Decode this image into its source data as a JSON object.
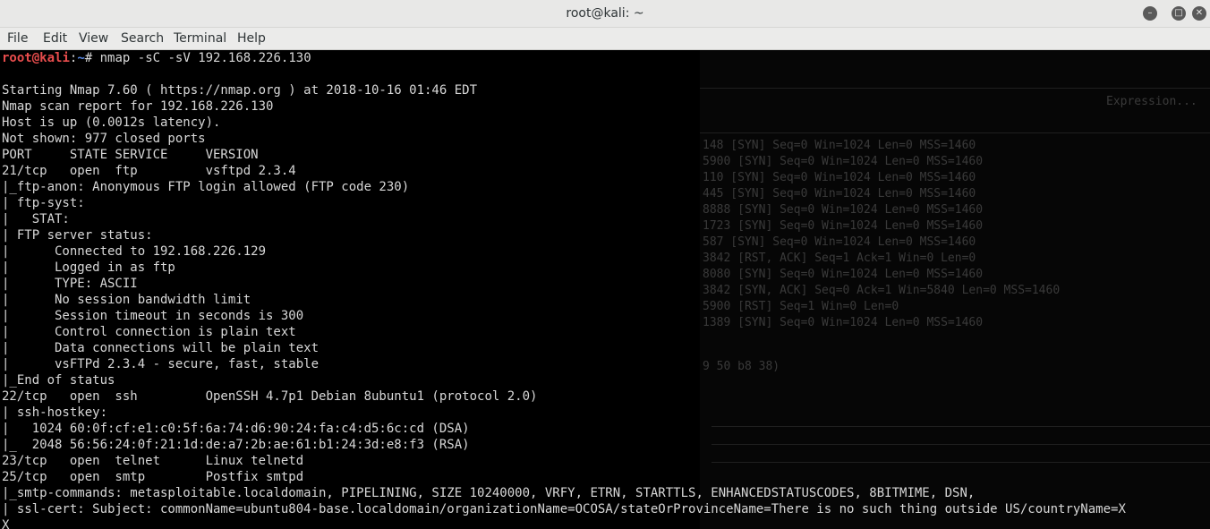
{
  "window": {
    "title": "root@kali: ~"
  },
  "menu": [
    "File",
    "Edit",
    "View",
    "Search",
    "Terminal",
    "Help"
  ],
  "prompt": {
    "user": "root",
    "at": "@",
    "host": "kali",
    "sep": ":",
    "path": "~",
    "symbol": "#",
    "command": " nmap -sC -sV 192.168.226.130"
  },
  "output": [
    "",
    "Starting Nmap 7.60 ( https://nmap.org ) at 2018-10-16 01:46 EDT",
    "Nmap scan report for 192.168.226.130",
    "Host is up (0.0012s latency).",
    "Not shown: 977 closed ports",
    "PORT     STATE SERVICE     VERSION",
    "21/tcp   open  ftp         vsftpd 2.3.4",
    "|_ftp-anon: Anonymous FTP login allowed (FTP code 230)",
    "| ftp-syst: ",
    "|   STAT: ",
    "| FTP server status:",
    "|      Connected to 192.168.226.129",
    "|      Logged in as ftp",
    "|      TYPE: ASCII",
    "|      No session bandwidth limit",
    "|      Session timeout in seconds is 300",
    "|      Control connection is plain text",
    "|      Data connections will be plain text",
    "|      vsFTPd 2.3.4 - secure, fast, stable",
    "|_End of status",
    "22/tcp   open  ssh         OpenSSH 4.7p1 Debian 8ubuntu1 (protocol 2.0)",
    "| ssh-hostkey: ",
    "|   1024 60:0f:cf:e1:c0:5f:6a:74:d6:90:24:fa:c4:d5:6c:cd (DSA)",
    "|_  2048 56:56:24:0f:21:1d:de:a7:2b:ae:61:b1:24:3d:e8:f3 (RSA)",
    "23/tcp   open  telnet      Linux telnetd",
    "25/tcp   open  smtp        Postfix smtpd",
    "|_smtp-commands: metasploitable.localdomain, PIPELINING, SIZE 10240000, VRFY, ETRN, STARTTLS, ENHANCEDSTATUSCODES, 8BITMIME, DSN,",
    "| ssl-cert: Subject: commonName=ubuntu804-base.localdomain/organizationName=OCOSA/stateOrProvinceName=There is no such thing outside US/countryName=X",
    "X"
  ],
  "background_ghost": [
    "148 [SYN] Seq=0 Win=1024 Len=0 MSS=1460",
    "5900 [SYN] Seq=0 Win=1024 Len=0 MSS=1460",
    "110 [SYN] Seq=0 Win=1024 Len=0 MSS=1460",
    "445 [SYN] Seq=0 Win=1024 Len=0 MSS=1460",
    "8888 [SYN] Seq=0 Win=1024 Len=0 MSS=1460",
    "1723 [SYN] Seq=0 Win=1024 Len=0 MSS=1460",
    "587 [SYN] Seq=0 Win=1024 Len=0 MSS=1460",
    "3842 [RST, ACK] Seq=1 Ack=1 Win=0 Len=0",
    "8080 [SYN] Seq=0 Win=1024 Len=0 MSS=1460",
    "3842 [SYN, ACK] Seq=0 Ack=1 Win=5840 Len=0 MSS=1460",
    "5900 [RST] Seq=1 Win=0 Len=0",
    "1389 [SYN] Seq=0 Win=1024 Len=0 MSS=1460"
  ],
  "background_misc": {
    "expression": "Expression...",
    "mac": "9 50 b8 38)"
  },
  "colors": {
    "prompt": "#e84d4d",
    "path": "#5a8ae8",
    "text": "#d8d8d8",
    "background": "#000000"
  }
}
